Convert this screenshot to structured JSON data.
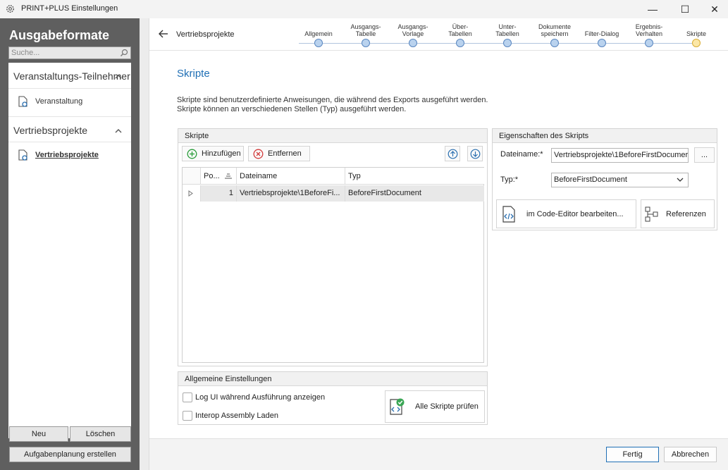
{
  "window": {
    "title": "PRINT+PLUS Einstellungen",
    "icon": "gear-icon",
    "controls": {
      "minimize": "—",
      "maximize": "☐",
      "close": "✕"
    }
  },
  "sidebar": {
    "title": "Ausgabeformate",
    "search_placeholder": "Suche...",
    "sections": [
      {
        "label": "Veranstaltungs-Teilnehmer",
        "items": [
          {
            "label": "Veranstaltung"
          }
        ]
      },
      {
        "label": "Vertriebsprojekte",
        "items": [
          {
            "label": "Vertriebsprojekte",
            "active": true
          }
        ]
      }
    ],
    "buttons": {
      "new": "Neu",
      "delete": "Löschen",
      "schedule": "Aufgabenplanung erstellen"
    }
  },
  "header": {
    "breadcrumb": "Vertriebsprojekte",
    "steps": [
      {
        "l1": "",
        "l2": "Allgemein"
      },
      {
        "l1": "Ausgangs-",
        "l2": "Tabelle"
      },
      {
        "l1": "Ausgangs-",
        "l2": "Vorlage"
      },
      {
        "l1": "Über-",
        "l2": "Tabellen"
      },
      {
        "l1": "Unter-",
        "l2": "Tabellen"
      },
      {
        "l1": "Dokumente",
        "l2": "speichern"
      },
      {
        "l1": "",
        "l2": "Filter-Dialog"
      },
      {
        "l1": "Ergebnis-",
        "l2": "Verhalten"
      },
      {
        "l1": "",
        "l2": "Skripte",
        "current": true
      }
    ]
  },
  "page": {
    "heading": "Skripte",
    "description_line1": "Skripte sind benutzerdefinierte Anweisungen, die während des Exports ausgeführt werden.",
    "description_line2": "Skripte können an verschiedenen Stellen (Typ) ausgeführt werden."
  },
  "scripts_group": {
    "title": "Skripte",
    "add_label": "Hinzufügen",
    "remove_label": "Entfernen",
    "columns": [
      "Po...",
      "Dateiname",
      "Typ"
    ],
    "rows": [
      {
        "pos": "1",
        "file": "Vertriebsprojekte\\1BeforeFi...",
        "type": "BeforeFirstDocument"
      }
    ]
  },
  "properties_group": {
    "title": "Eigenschaften des Skripts",
    "filename_label": "Dateiname:*",
    "filename_value": "Vertriebsprojekte\\1BeforeFirstDocumer",
    "browse_label": "...",
    "type_label": "Typ:*",
    "type_value": "BeforeFirstDocument",
    "edit_label": "im Code-Editor bearbeiten...",
    "references_label": "Referenzen"
  },
  "general_group": {
    "title": "Allgemeine Einstellungen",
    "log_ui_label": "Log UI während Ausführung anzeigen",
    "log_ui_checked": false,
    "interop_label": "Interop Assembly Laden",
    "interop_checked": false,
    "check_all_label": "Alle Skripte prüfen"
  },
  "footer": {
    "finish": "Fertig",
    "cancel": "Abbrechen"
  },
  "colors": {
    "accent": "#1f6fb5",
    "sidebar_bg": "#5f5f5f",
    "step_dot": "#b9d2ee",
    "step_current": "#fbe7a6"
  }
}
